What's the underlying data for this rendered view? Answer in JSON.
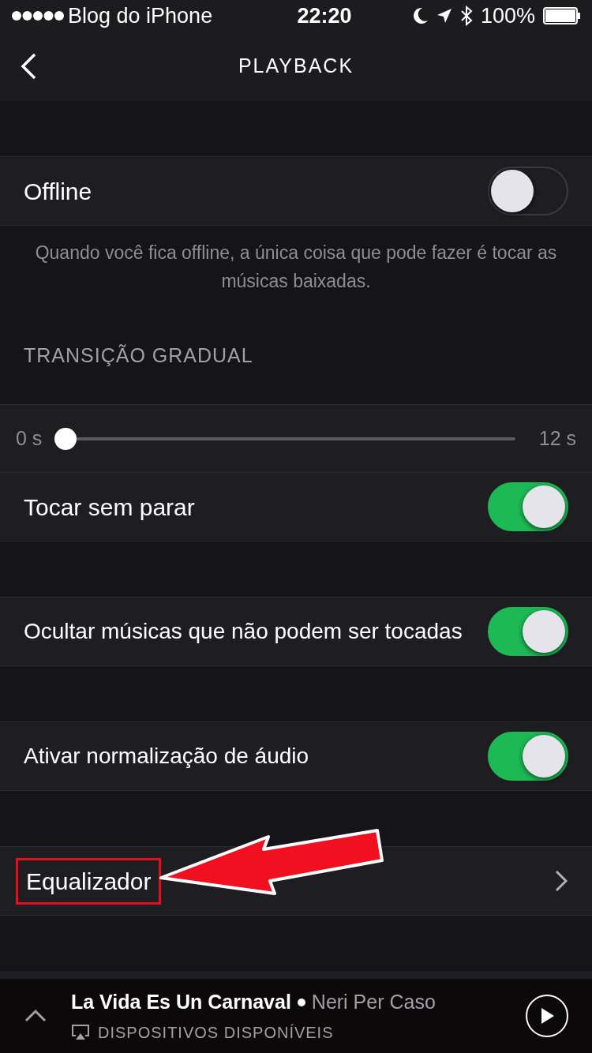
{
  "status_bar": {
    "carrier": "Blog do iPhone",
    "time": "22:20",
    "battery": "100%"
  },
  "nav": {
    "title": "PLAYBACK"
  },
  "offline": {
    "label": "Offline",
    "on": false,
    "description": "Quando você fica offline, a única coisa que pode fazer é tocar as músicas baixadas."
  },
  "crossfade": {
    "header": "TRANSIÇÃO GRADUAL",
    "min": "0 s",
    "max": "12 s",
    "level": 0
  },
  "settings": [
    {
      "label": "Tocar sem parar",
      "on": true
    },
    {
      "label": "Ocultar músicas que não podem ser tocadas",
      "on": true
    },
    {
      "label": "Ativar normalização de áudio",
      "on": true
    }
  ],
  "equalizer": {
    "label": "Equalizador",
    "highlighted": true
  },
  "now_playing": {
    "title": "La Vida Es Un Carnaval",
    "artist": "Neri Per Caso",
    "devices": "DISPOSITIVOS DISPONÍVEIS"
  }
}
